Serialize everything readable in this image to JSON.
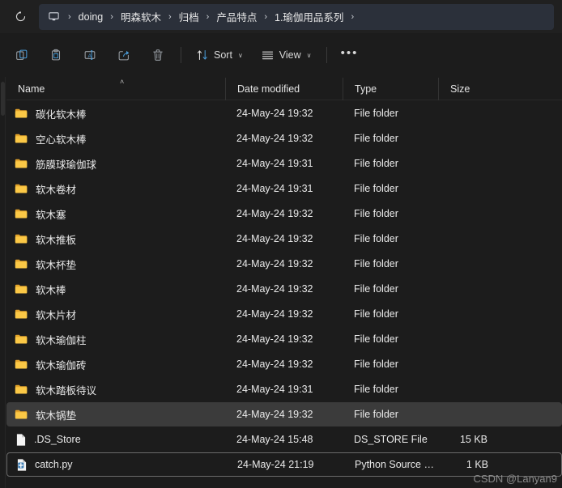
{
  "window": {
    "theme": "dark",
    "accent_color": "#4a9bd8",
    "background_color": "#1c1c1c",
    "addressbar_color": "#2b303a",
    "selection_color": "#3b3b3b",
    "folder_icon_color": "#f5bd42"
  },
  "addressbar": {
    "refresh_label": "Refresh",
    "refresh_icon": "refresh-icon",
    "home_icon": "this-pc-icon",
    "separator": "›",
    "crumbs": [
      {
        "label": "doing"
      },
      {
        "label": "明森软木"
      },
      {
        "label": "归档"
      },
      {
        "label": "产品特点"
      },
      {
        "label": "1.瑜伽用品系列"
      }
    ]
  },
  "toolbar": {
    "buttons": [
      {
        "name": "copy-button",
        "icon": "copy-icon",
        "label": ""
      },
      {
        "name": "paste-button",
        "icon": "paste-icon",
        "label": ""
      },
      {
        "name": "rename-button",
        "icon": "rename-icon",
        "label": ""
      },
      {
        "name": "share-button",
        "icon": "share-icon",
        "label": ""
      },
      {
        "name": "delete-button",
        "icon": "trash-icon",
        "label": ""
      }
    ],
    "sort_label": "Sort",
    "view_label": "View",
    "more_label": "See more",
    "chevron": "∨"
  },
  "columns": {
    "name": "Name",
    "date_modified": "Date modified",
    "type": "Type",
    "size": "Size",
    "sort_indicator": "˄",
    "sorted_by": "Name",
    "sort_direction": "ascending"
  },
  "files": [
    {
      "name": "碳化软木棒",
      "date": "24-May-24 19:32",
      "type": "File folder",
      "size": "",
      "kind": "folder",
      "selected": false,
      "focused": false
    },
    {
      "name": "空心软木棒",
      "date": "24-May-24 19:32",
      "type": "File folder",
      "size": "",
      "kind": "folder",
      "selected": false,
      "focused": false
    },
    {
      "name": "筋膜球瑜伽球",
      "date": "24-May-24 19:31",
      "type": "File folder",
      "size": "",
      "kind": "folder",
      "selected": false,
      "focused": false
    },
    {
      "name": "软木卷材",
      "date": "24-May-24 19:31",
      "type": "File folder",
      "size": "",
      "kind": "folder",
      "selected": false,
      "focused": false
    },
    {
      "name": "软木塞",
      "date": "24-May-24 19:32",
      "type": "File folder",
      "size": "",
      "kind": "folder",
      "selected": false,
      "focused": false
    },
    {
      "name": "软木推板",
      "date": "24-May-24 19:32",
      "type": "File folder",
      "size": "",
      "kind": "folder",
      "selected": false,
      "focused": false
    },
    {
      "name": "软木杯垫",
      "date": "24-May-24 19:32",
      "type": "File folder",
      "size": "",
      "kind": "folder",
      "selected": false,
      "focused": false
    },
    {
      "name": "软木棒",
      "date": "24-May-24 19:32",
      "type": "File folder",
      "size": "",
      "kind": "folder",
      "selected": false,
      "focused": false
    },
    {
      "name": "软木片材",
      "date": "24-May-24 19:32",
      "type": "File folder",
      "size": "",
      "kind": "folder",
      "selected": false,
      "focused": false
    },
    {
      "name": "软木瑜伽柱",
      "date": "24-May-24 19:32",
      "type": "File folder",
      "size": "",
      "kind": "folder",
      "selected": false,
      "focused": false
    },
    {
      "name": "软木瑜伽砖",
      "date": "24-May-24 19:32",
      "type": "File folder",
      "size": "",
      "kind": "folder",
      "selected": false,
      "focused": false
    },
    {
      "name": "软木踏板待议",
      "date": "24-May-24 19:31",
      "type": "File folder",
      "size": "",
      "kind": "folder",
      "selected": false,
      "focused": false
    },
    {
      "name": "软木锅垫",
      "date": "24-May-24 19:32",
      "type": "File folder",
      "size": "",
      "kind": "folder",
      "selected": true,
      "focused": false
    },
    {
      "name": ".DS_Store",
      "date": "24-May-24 15:48",
      "type": "DS_STORE File",
      "size": "15 KB",
      "kind": "file",
      "selected": false,
      "focused": false
    },
    {
      "name": "catch.py",
      "date": "24-May-24 21:19",
      "type": "Python Source File",
      "size": "1 KB",
      "kind": "python",
      "selected": false,
      "focused": true
    }
  ],
  "watermark": {
    "text": "CSDN @Lanyan9"
  }
}
